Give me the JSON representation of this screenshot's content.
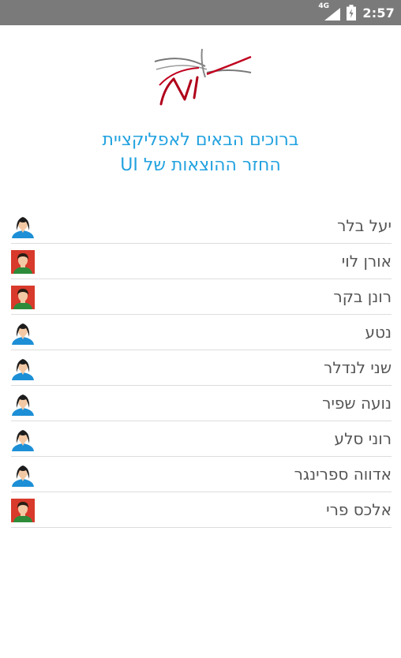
{
  "status_bar": {
    "network": "4G",
    "time": "2:57"
  },
  "welcome": {
    "line1": "ברוכים הבאים לאפליקציית",
    "line2": "החזר ההוצאות של UI"
  },
  "colors": {
    "accent": "#22a2df",
    "status_bar": "#7a7a7a",
    "name_text": "#555555"
  },
  "contacts": [
    {
      "name": "יעל בלר",
      "avatar": "female-avatar-icon"
    },
    {
      "name": "אורן לוי",
      "avatar": "male-avatar-icon"
    },
    {
      "name": "רונן בקר",
      "avatar": "male-avatar-icon"
    },
    {
      "name": "נטע",
      "avatar": "female-avatar-icon"
    },
    {
      "name": "שני לנדלר",
      "avatar": "female-avatar-icon"
    },
    {
      "name": "נועה שפיר",
      "avatar": "female-avatar-icon"
    },
    {
      "name": "רוני סלע",
      "avatar": "female-avatar-icon"
    },
    {
      "name": "אדווה ספרינגר",
      "avatar": "female-avatar-icon"
    },
    {
      "name": "אלכס פרי",
      "avatar": "male-avatar-icon"
    }
  ]
}
